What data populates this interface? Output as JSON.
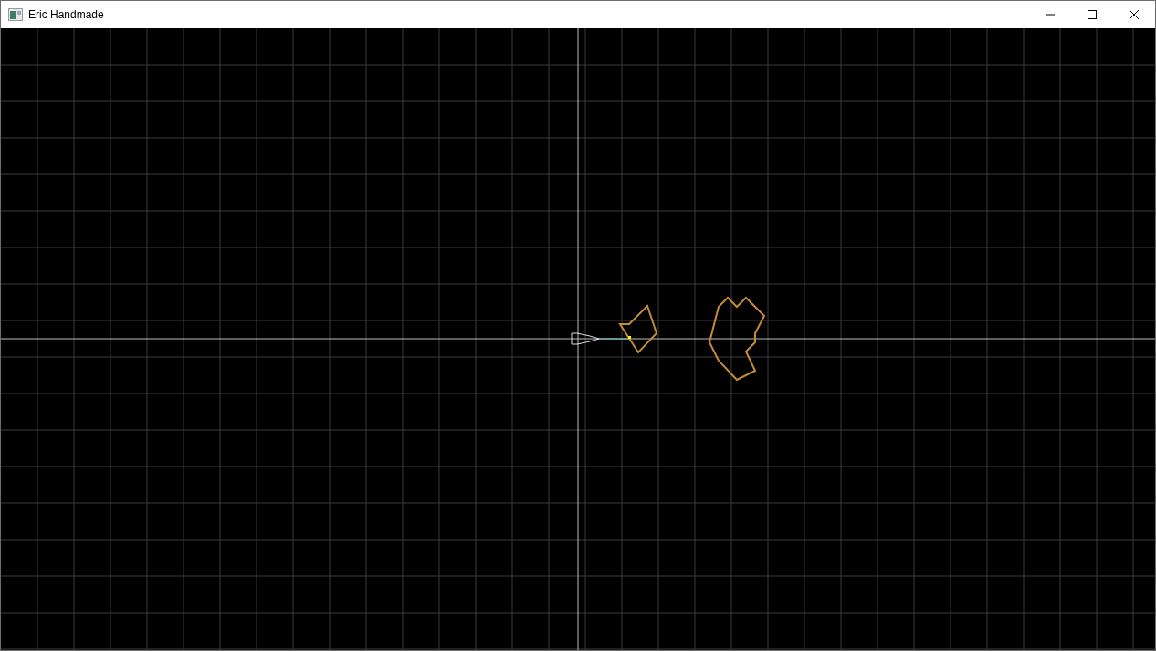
{
  "window": {
    "title": "Eric Handmade"
  }
}
